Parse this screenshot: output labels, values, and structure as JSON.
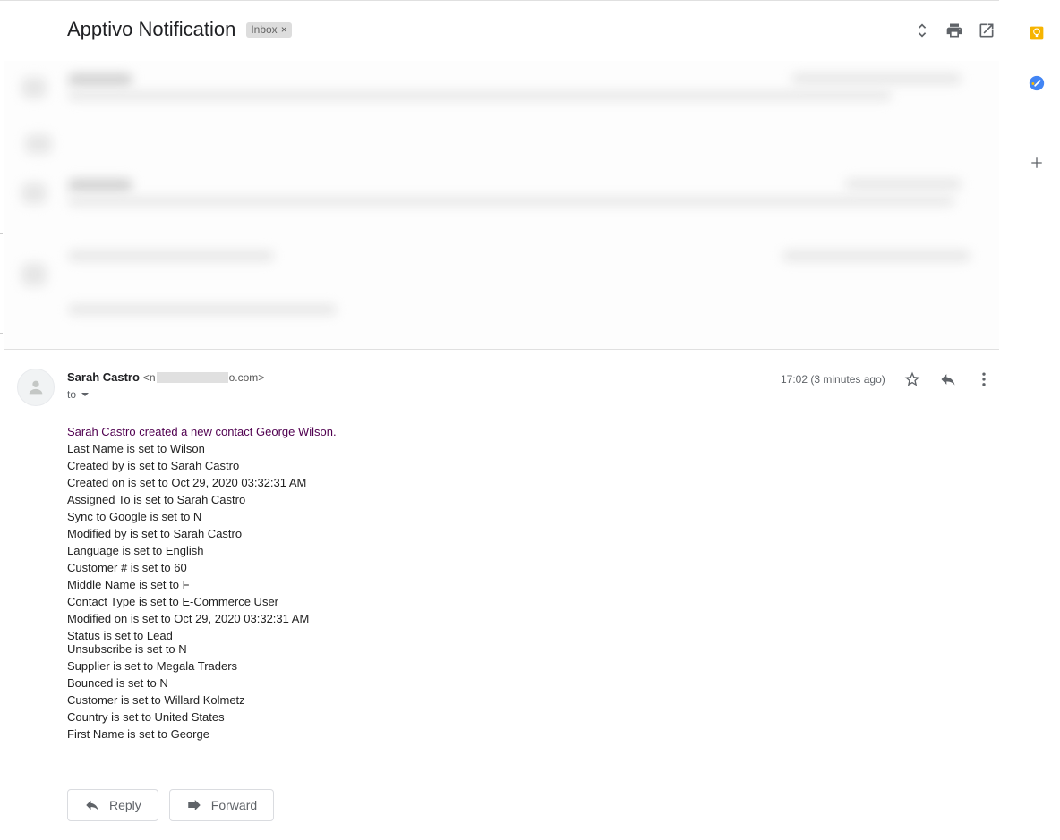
{
  "header": {
    "subject": "Apptivo Notification",
    "label_chip": "Inbox",
    "label_chip_close": "×",
    "actions": [
      {
        "name": "expand-collapse-icon"
      },
      {
        "name": "print-icon"
      },
      {
        "name": "open-in-new-window-icon"
      }
    ]
  },
  "message": {
    "sender_name": "Sarah Castro",
    "sender_email_prefix": "<n",
    "sender_email_suffix": "o.com>",
    "to_label": "to",
    "timestamp": "17:02 (3 minutes ago)",
    "headline": "Sarah Castro created a new contact George Wilson.",
    "lines": [
      "Last Name is set to Wilson",
      "Created by is set to Sarah Castro",
      "Created on is set to Oct 29, 2020 03:32:31 AM",
      "Assigned To is set to Sarah Castro",
      "Sync to Google is set to N",
      "Modified by is set to Sarah Castro",
      "Language is set to English",
      "Customer # is set to 60",
      "Middle Name is set to F",
      "Contact Type is set to E-Commerce User",
      "Modified on is set to Oct 29, 2020 03:32:31 AM"
    ],
    "clipped_line": "Status is set to Lead",
    "lines_after": [
      "Unsubscribe is set to N",
      "Supplier is set to Megala Traders",
      "Bounced is set to N",
      "Customer is set to Willard Kolmetz",
      "Country is set to United States",
      "First Name is set to George"
    ]
  },
  "footer_actions": {
    "reply": "Reply",
    "forward": "Forward"
  },
  "right_rail": {
    "items": [
      "keep-icon",
      "tasks-icon",
      "add-addon-icon"
    ]
  },
  "colors": {
    "headline": "#500050",
    "keep": "#f6b400",
    "tasks": "#4285f4"
  }
}
